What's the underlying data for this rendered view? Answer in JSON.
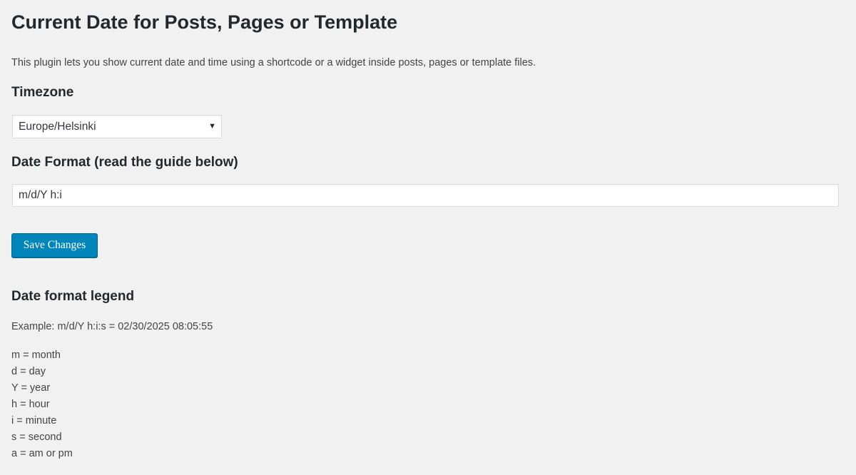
{
  "page": {
    "title": "Current Date for Posts, Pages or Template",
    "description": "This plugin lets you show current date and time using a shortcode or a widget inside posts, pages or template files."
  },
  "timezone": {
    "heading": "Timezone",
    "selected": "Europe/Helsinki"
  },
  "date_format": {
    "heading": "Date Format (read the guide below)",
    "value": "m/d/Y h:i"
  },
  "actions": {
    "save_label": "Save Changes"
  },
  "legend": {
    "heading": "Date format legend",
    "example": "Example: m/d/Y h:i:s = 02/30/2025 08:05:55",
    "items": [
      "m = month",
      "d = day",
      "Y = year",
      "h = hour",
      "i = minute",
      "s = second",
      "a = am or pm"
    ]
  },
  "icons": {
    "select_arrow": "chevron-down-icon"
  },
  "colors": {
    "background": "#f1f1f1",
    "primary_button": "#0085ba",
    "primary_button_border": "#006799",
    "heading_text": "#23282d",
    "body_text": "#444444"
  }
}
